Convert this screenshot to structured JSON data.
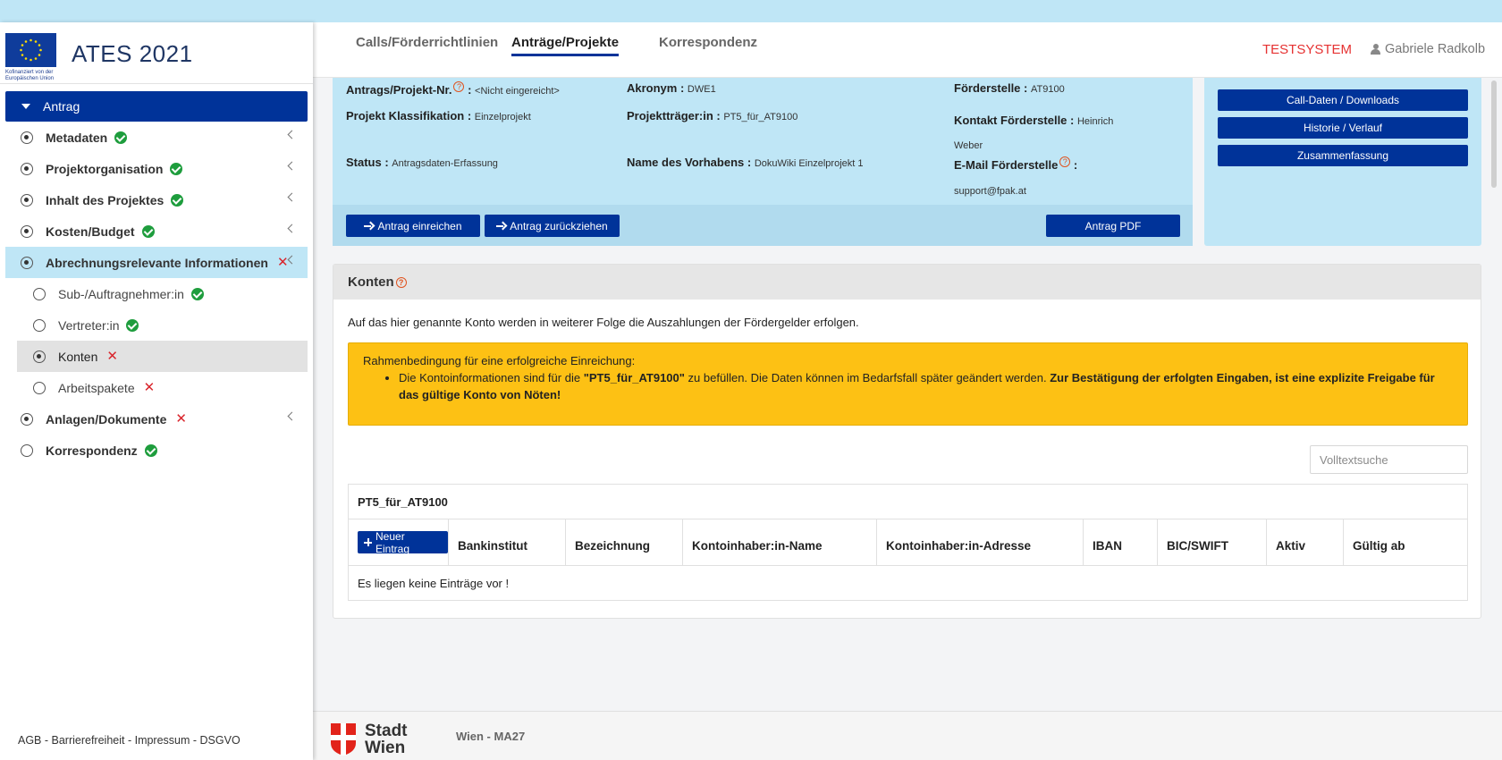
{
  "brand": {
    "title": "ATES 2021",
    "eu_caption": "Kofinanziert von der Europäischen Union"
  },
  "nav": {
    "section": "Antrag",
    "items": [
      {
        "label": "Metadaten",
        "status": "ok"
      },
      {
        "label": "Projektorganisation",
        "status": "ok"
      },
      {
        "label": "Inhalt des Projektes",
        "status": "ok"
      },
      {
        "label": "Kosten/Budget",
        "status": "ok"
      },
      {
        "label": "Abrechnungsrelevante Informationen",
        "status": "error"
      },
      {
        "label": "Sub-/Auftragnehmer:in",
        "status": "ok"
      },
      {
        "label": "Vertreter:in",
        "status": "ok"
      },
      {
        "label": "Konten",
        "status": "error"
      },
      {
        "label": "Arbeitspakete",
        "status": "error"
      },
      {
        "label": "Anlagen/Dokumente",
        "status": "error"
      },
      {
        "label": "Korrespondenz",
        "status": "ok"
      }
    ]
  },
  "sidebar_footer": "AGB - Barrierefreiheit - Impressum - DSGVO",
  "header": {
    "tabs": [
      "Calls/Förderrichtlinien",
      "Anträge/Projekte",
      "Korrespondenz"
    ],
    "active_tab": "Anträge/Projekte",
    "system_label": "TESTSYSTEM",
    "user_name": "Gabriele Radkolb"
  },
  "info": {
    "antrag_nr_label": "Antrags/Projekt-Nr.",
    "antrag_nr_value": "<Nicht eingereicht>",
    "akronym_label": "Akronym :",
    "akronym_value": "DWE1",
    "foerderstelle_label": "Förderstelle :",
    "foerderstelle_value": "AT9100",
    "klassifikation_label": "Projekt Klassifikation :",
    "klassifikation_value": "Einzelprojekt",
    "projekttraeger_label": "Projektträger:in :",
    "projekttraeger_value": "PT5_für_AT9100",
    "kontakt_label": "Kontakt Förderstelle :",
    "kontakt_value_1": "Heinrich",
    "kontakt_value_2": "Weber",
    "status_label": "Status :",
    "status_value": "Antragsdaten-Erfassung",
    "vorhaben_label": "Name des Vorhabens :",
    "vorhaben_value": "DokuWiki Einzelprojekt 1",
    "email_label": "E-Mail Förderstelle",
    "email_value": "support@fpak.at"
  },
  "actions": {
    "einreichen": "Antrag einreichen",
    "zurueckziehen": "Antrag zurückziehen",
    "pdf": "Antrag PDF"
  },
  "side_buttons": [
    "Call-Daten / Downloads",
    "Historie / Verlauf",
    "Zusammenfassung"
  ],
  "konten": {
    "title": "Konten",
    "intro": "Auf das hier genannte Konto werden in weiterer Folge die Auszahlungen der Fördergelder erfolgen.",
    "alert_title": "Rahmenbedingung für eine erfolgreiche Einreichung:",
    "alert_text_1": "Die Kontoinformationen sind für die ",
    "alert_bold_1": "\"PT5_für_AT9100\"",
    "alert_text_2": " zu befüllen. Die Daten können im Bedarfsfall später geändert werden. ",
    "alert_bold_2": "Zur Bestätigung der erfolgten Eingaben, ist eine explizite Freigabe für das gültige Konto von Nöten!",
    "search_placeholder": "Volltextsuche",
    "table_title": "PT5_für_AT9100",
    "new_button": "Neuer Eintrag",
    "columns": [
      "Bankinstitut",
      "Bezeichnung",
      "Kontoinhaber:in-Name",
      "Kontoinhaber:in-Adresse",
      "IBAN",
      "BIC/SWIFT",
      "Aktiv",
      "Gültig ab"
    ],
    "empty_text": "Es liegen keine Einträge vor !"
  },
  "footer": {
    "logo_text_1": "Stadt",
    "logo_text_2": "Wien",
    "org": "Wien - MA27"
  },
  "colors": {
    "primary": "#003399",
    "light_blue": "#bfe6f6",
    "warning": "#fdc114",
    "success": "#1e9d3d",
    "error": "#d9252c",
    "testsystem": "#e63232"
  }
}
